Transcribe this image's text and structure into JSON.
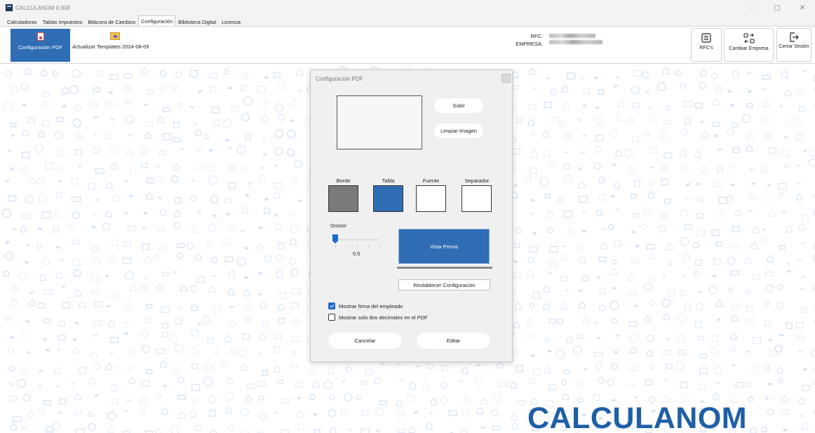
{
  "window": {
    "title": "CALCULANOM 0.908",
    "controls": {
      "minimize": "–",
      "maximize": "▢",
      "close": "✕"
    }
  },
  "tabs": [
    {
      "label": "Calculadoras",
      "active": false
    },
    {
      "label": "Tablas Impuestos",
      "active": false
    },
    {
      "label": "Bitácora de Cambios",
      "active": false
    },
    {
      "label": "Configuración",
      "active": true
    },
    {
      "label": "Biblioteca Digital",
      "active": false
    },
    {
      "label": "Licencia",
      "active": false
    }
  ],
  "ribbon": {
    "config_pdf_label": "Configuración PDF",
    "templates_label": "Actualizar Templates 2024-08-09",
    "rfc_label": "RFC:",
    "empresa_label": "EMPRESA:",
    "rfcs_button": "RFC's",
    "cambiar_empresa_button": "Cambiar Empresa",
    "cerrar_sesion_button": "Cerrar Sesión",
    "accent_color": "#2f6db5"
  },
  "dialog": {
    "title": "Configuración PDF",
    "subir_button": "Subir",
    "limpiar_button": "Limpiar Imagen",
    "swatches": [
      {
        "label": "Borde",
        "color": "#7a7a7a"
      },
      {
        "label": "Tabla",
        "color": "#2f6db5"
      },
      {
        "label": "Fuente",
        "color": "#ffffff"
      },
      {
        "label": "Separador",
        "color": "#ffffff"
      }
    ],
    "grosor_label": "Grosor",
    "grosor_value": "0.5",
    "grosor_slider_fraction": 0.05,
    "preview_label": "Vista Previa",
    "restablecer_button": "Restablecer Configuración",
    "checkbox_firma": {
      "label": "Mostrar firma del empleado",
      "checked": true
    },
    "checkbox_decimales": {
      "label": "Mostrar solo dos decimales en el PDF",
      "checked": false
    },
    "cancelar_button": "Cancelar",
    "editar_button": "Editar"
  },
  "brand_text": "CALCULANOM"
}
